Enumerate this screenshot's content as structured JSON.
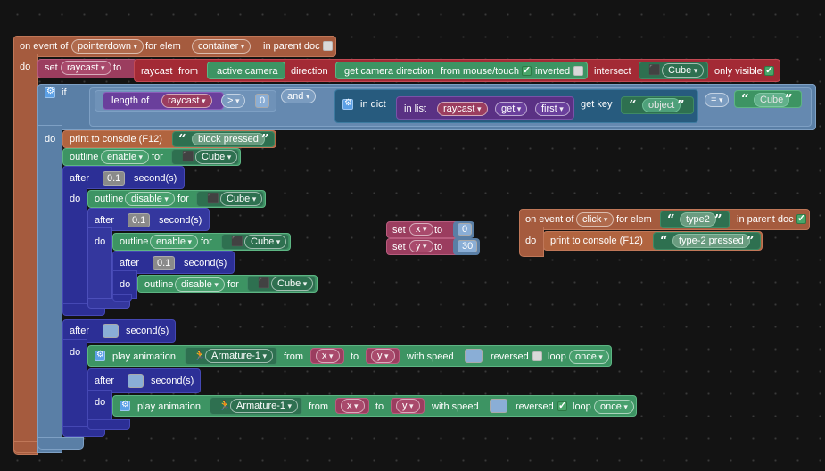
{
  "event1": {
    "on_event_of": "on event of",
    "event": "pointerdown",
    "for_elem": "for elem",
    "elem": "container",
    "in_parent_doc": "in parent doc",
    "in_parent_doc_checked": false,
    "do": "do"
  },
  "set_raycast": {
    "set": "set",
    "var": "raycast",
    "to": "to",
    "raycast_label": "raycast",
    "from": "from",
    "from_val": "active camera",
    "direction": "direction",
    "dir_label": "get camera direction",
    "dir_from": "from mouse/touch",
    "dir_from_checked": true,
    "inverted": "inverted",
    "inverted_checked": false,
    "intersect": "intersect",
    "intersect_val": "Cube",
    "only_visible": "only visible",
    "only_visible_checked": true
  },
  "if_block": {
    "if": "if",
    "length_of": "length of",
    "length_var": "raycast",
    "op": ">",
    "num": "0",
    "and": "and",
    "in_dict": "in dict",
    "in_list": "in list",
    "list_var": "raycast",
    "get": "get",
    "first": "first",
    "get_key": "get key",
    "key": "object",
    "eq": "=",
    "cube_str": "Cube",
    "do": "do"
  },
  "print1": {
    "label": "print to console (F12)",
    "value": "block pressed"
  },
  "outline1": {
    "outline": "outline",
    "mode": "enable",
    "for": "for",
    "obj": "Cube"
  },
  "after1": {
    "after": "after",
    "num": "0.1",
    "seconds": "second(s)",
    "do": "do"
  },
  "outline2": {
    "outline": "outline",
    "mode": "disable",
    "for": "for",
    "obj": "Cube"
  },
  "after2": {
    "after": "after",
    "num": "0.1",
    "seconds": "second(s)",
    "do": "do"
  },
  "outline3": {
    "outline": "outline",
    "mode": "enable",
    "for": "for",
    "obj": "Cube"
  },
  "after3": {
    "after": "after",
    "num": "0.1",
    "seconds": "second(s)",
    "do": "do"
  },
  "outline4": {
    "outline": "outline",
    "mode": "disable",
    "for": "for",
    "obj": "Cube"
  },
  "after4": {
    "after": "after",
    "num": "",
    "seconds": "second(s)",
    "do": "do"
  },
  "anim1": {
    "play": "play animation",
    "armature": "Armature-1",
    "from": "from",
    "from_var": "x",
    "to": "to",
    "to_var": "y",
    "speed": "with speed",
    "speed_val": "",
    "reversed": "reversed",
    "reversed_checked": false,
    "loop": "loop",
    "loop_val": "once"
  },
  "after5": {
    "after": "after",
    "num": "",
    "seconds": "second(s)",
    "do": "do"
  },
  "anim2": {
    "play": "play animation",
    "armature": "Armature-1",
    "from": "from",
    "from_var": "x",
    "to": "to",
    "to_var": "y",
    "speed": "with speed",
    "speed_val": "",
    "reversed": "reversed",
    "reversed_checked": true,
    "loop": "loop",
    "loop_val": "once"
  },
  "set_x": {
    "set": "set",
    "var": "x",
    "to": "to",
    "val": "0"
  },
  "set_y": {
    "set": "set",
    "var": "y",
    "to": "to",
    "val": "30"
  },
  "event2": {
    "on_event_of": "on event of",
    "event": "click",
    "for_elem": "for elem",
    "elem": "type2",
    "in_parent_doc": "in parent doc",
    "in_parent_doc_checked": true,
    "do": "do",
    "print": "print to console (F12)",
    "print_val": "type-2 pressed"
  },
  "colors": {
    "event": "#a55b3e",
    "control": "#5a7fa6",
    "timer": "#2c2f96",
    "outline": "#3d9463",
    "variable": "#9b3d5f",
    "raycast": "#a32a35",
    "list": "#6a3f9c"
  }
}
